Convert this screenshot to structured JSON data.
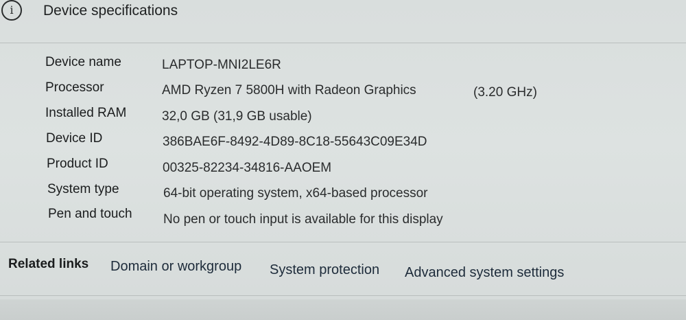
{
  "header": {
    "icon": "info-icon",
    "icon_glyph": "i",
    "title": "Device specifications"
  },
  "specs": [
    {
      "label": "Device name",
      "value": "LAPTOP-MNI2LE6R"
    },
    {
      "label": "Processor",
      "value": "AMD Ryzen 7 5800H with Radeon Graphics",
      "extra": "(3.20 GHz)"
    },
    {
      "label": "Installed RAM",
      "value": "32,0 GB (31,9 GB usable)"
    },
    {
      "label": "Device ID",
      "value": "386BAE6F-8492-4D89-8C18-55643C09E34D"
    },
    {
      "label": "Product ID",
      "value": "00325-82234-34816-AAOEM"
    },
    {
      "label": "System type",
      "value": "64-bit operating system, x64-based processor"
    },
    {
      "label": "Pen and touch",
      "value": "No pen or touch input is available for this display"
    }
  ],
  "related_links": {
    "title": "Related links",
    "items": [
      "Domain or workgroup",
      "System protection",
      "Advanced system settings"
    ]
  }
}
